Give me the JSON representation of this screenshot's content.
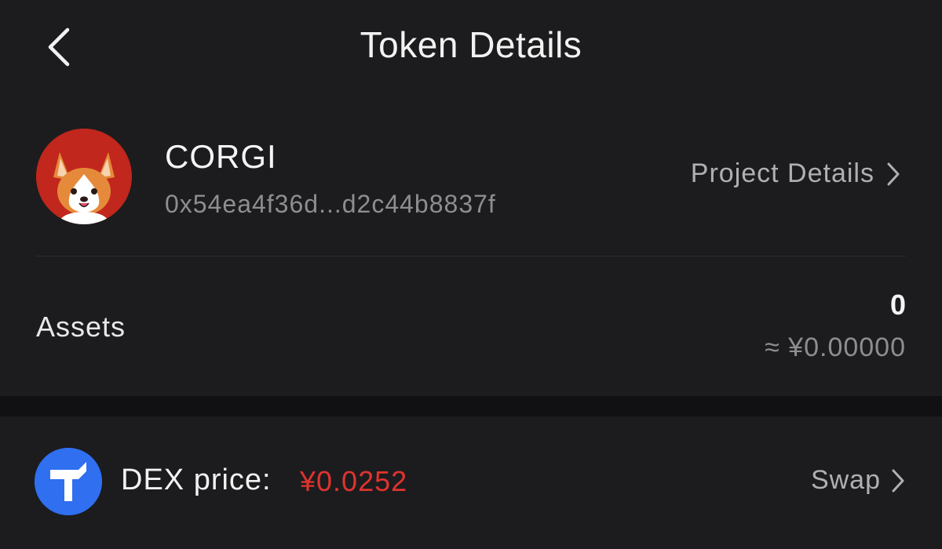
{
  "header": {
    "title": "Token Details",
    "back_icon": "chevron-left-icon"
  },
  "token": {
    "symbol": "CORGI",
    "address": "0x54ea4f36d...d2c44b8837f",
    "avatar_icon": "corgi-avatar",
    "avatar_color": "#c1271c",
    "project_details_label": "Project Details"
  },
  "assets": {
    "label": "Assets",
    "amount": "0",
    "fiat_value": "≈ ¥0.00000"
  },
  "dex": {
    "logo_icon": "dex-logo-icon",
    "logo_color": "#2f6ff0",
    "price_label": "DEX price:",
    "price_value": "¥0.0252",
    "price_color": "#e0332f",
    "swap_label": "Swap"
  }
}
